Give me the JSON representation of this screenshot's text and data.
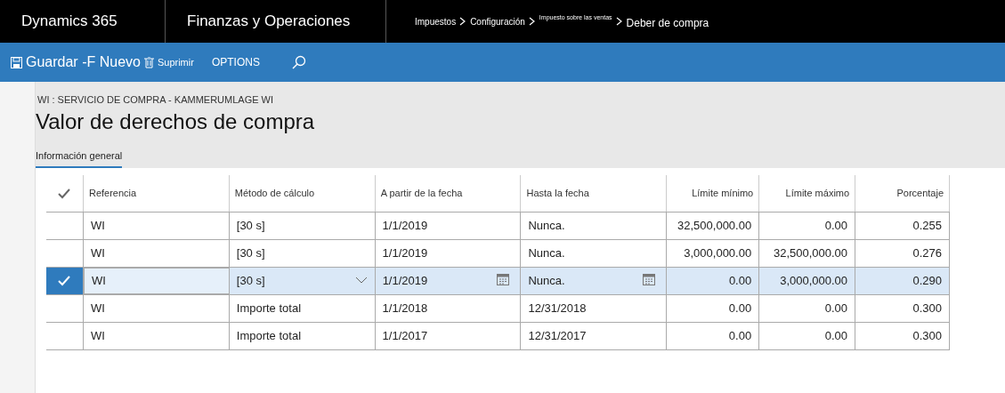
{
  "app": {
    "name": "Dynamics 365",
    "module": "Finanzas y Operaciones"
  },
  "breadcrumb": [
    "Impuestos",
    "Configuración",
    "Impuesto sobre las ventas",
    "Deber de compra"
  ],
  "toolbar": {
    "save": "Guardar -F Nuevo",
    "delete": "Suprimir",
    "options": "OPTIONS"
  },
  "page": {
    "subtitle": "WI : SERVICIO DE COMPRA - KAMMERUMLAGE WI",
    "title": "Valor de derechos de compra"
  },
  "tabs": [
    {
      "label": "Información general",
      "selected": true
    }
  ],
  "table": {
    "columns": [
      "Referencia",
      "Método de cálculo",
      "A partir de la fecha",
      "Hasta la fecha",
      "Límite mínimo",
      "Límite máximo",
      "Porcentaje"
    ],
    "rows": [
      {
        "selected": false,
        "cells": [
          "WI",
          "[30 s]",
          "1/1/2019",
          "Nunca.",
          "32,500,000.00",
          "0.00",
          "0.255"
        ]
      },
      {
        "selected": false,
        "cells": [
          "WI",
          "[30 s]",
          "1/1/2019",
          "Nunca.",
          "3,000,000.00",
          "32,500,000.00",
          "0.276"
        ]
      },
      {
        "selected": true,
        "cells": [
          "WI",
          "[30 s]",
          "1/1/2019",
          "Nunca.",
          "0.00",
          "3,000,000.00",
          "0.290"
        ]
      },
      {
        "selected": false,
        "cells": [
          "WI",
          "Importe total",
          "1/1/2018",
          "12/31/2018",
          "0.00",
          "0.00",
          "0.300"
        ]
      },
      {
        "selected": false,
        "cells": [
          "WI",
          "Importe total",
          "1/1/2017",
          "12/31/2017",
          "0.00",
          "0.00",
          "0.300"
        ]
      }
    ]
  }
}
